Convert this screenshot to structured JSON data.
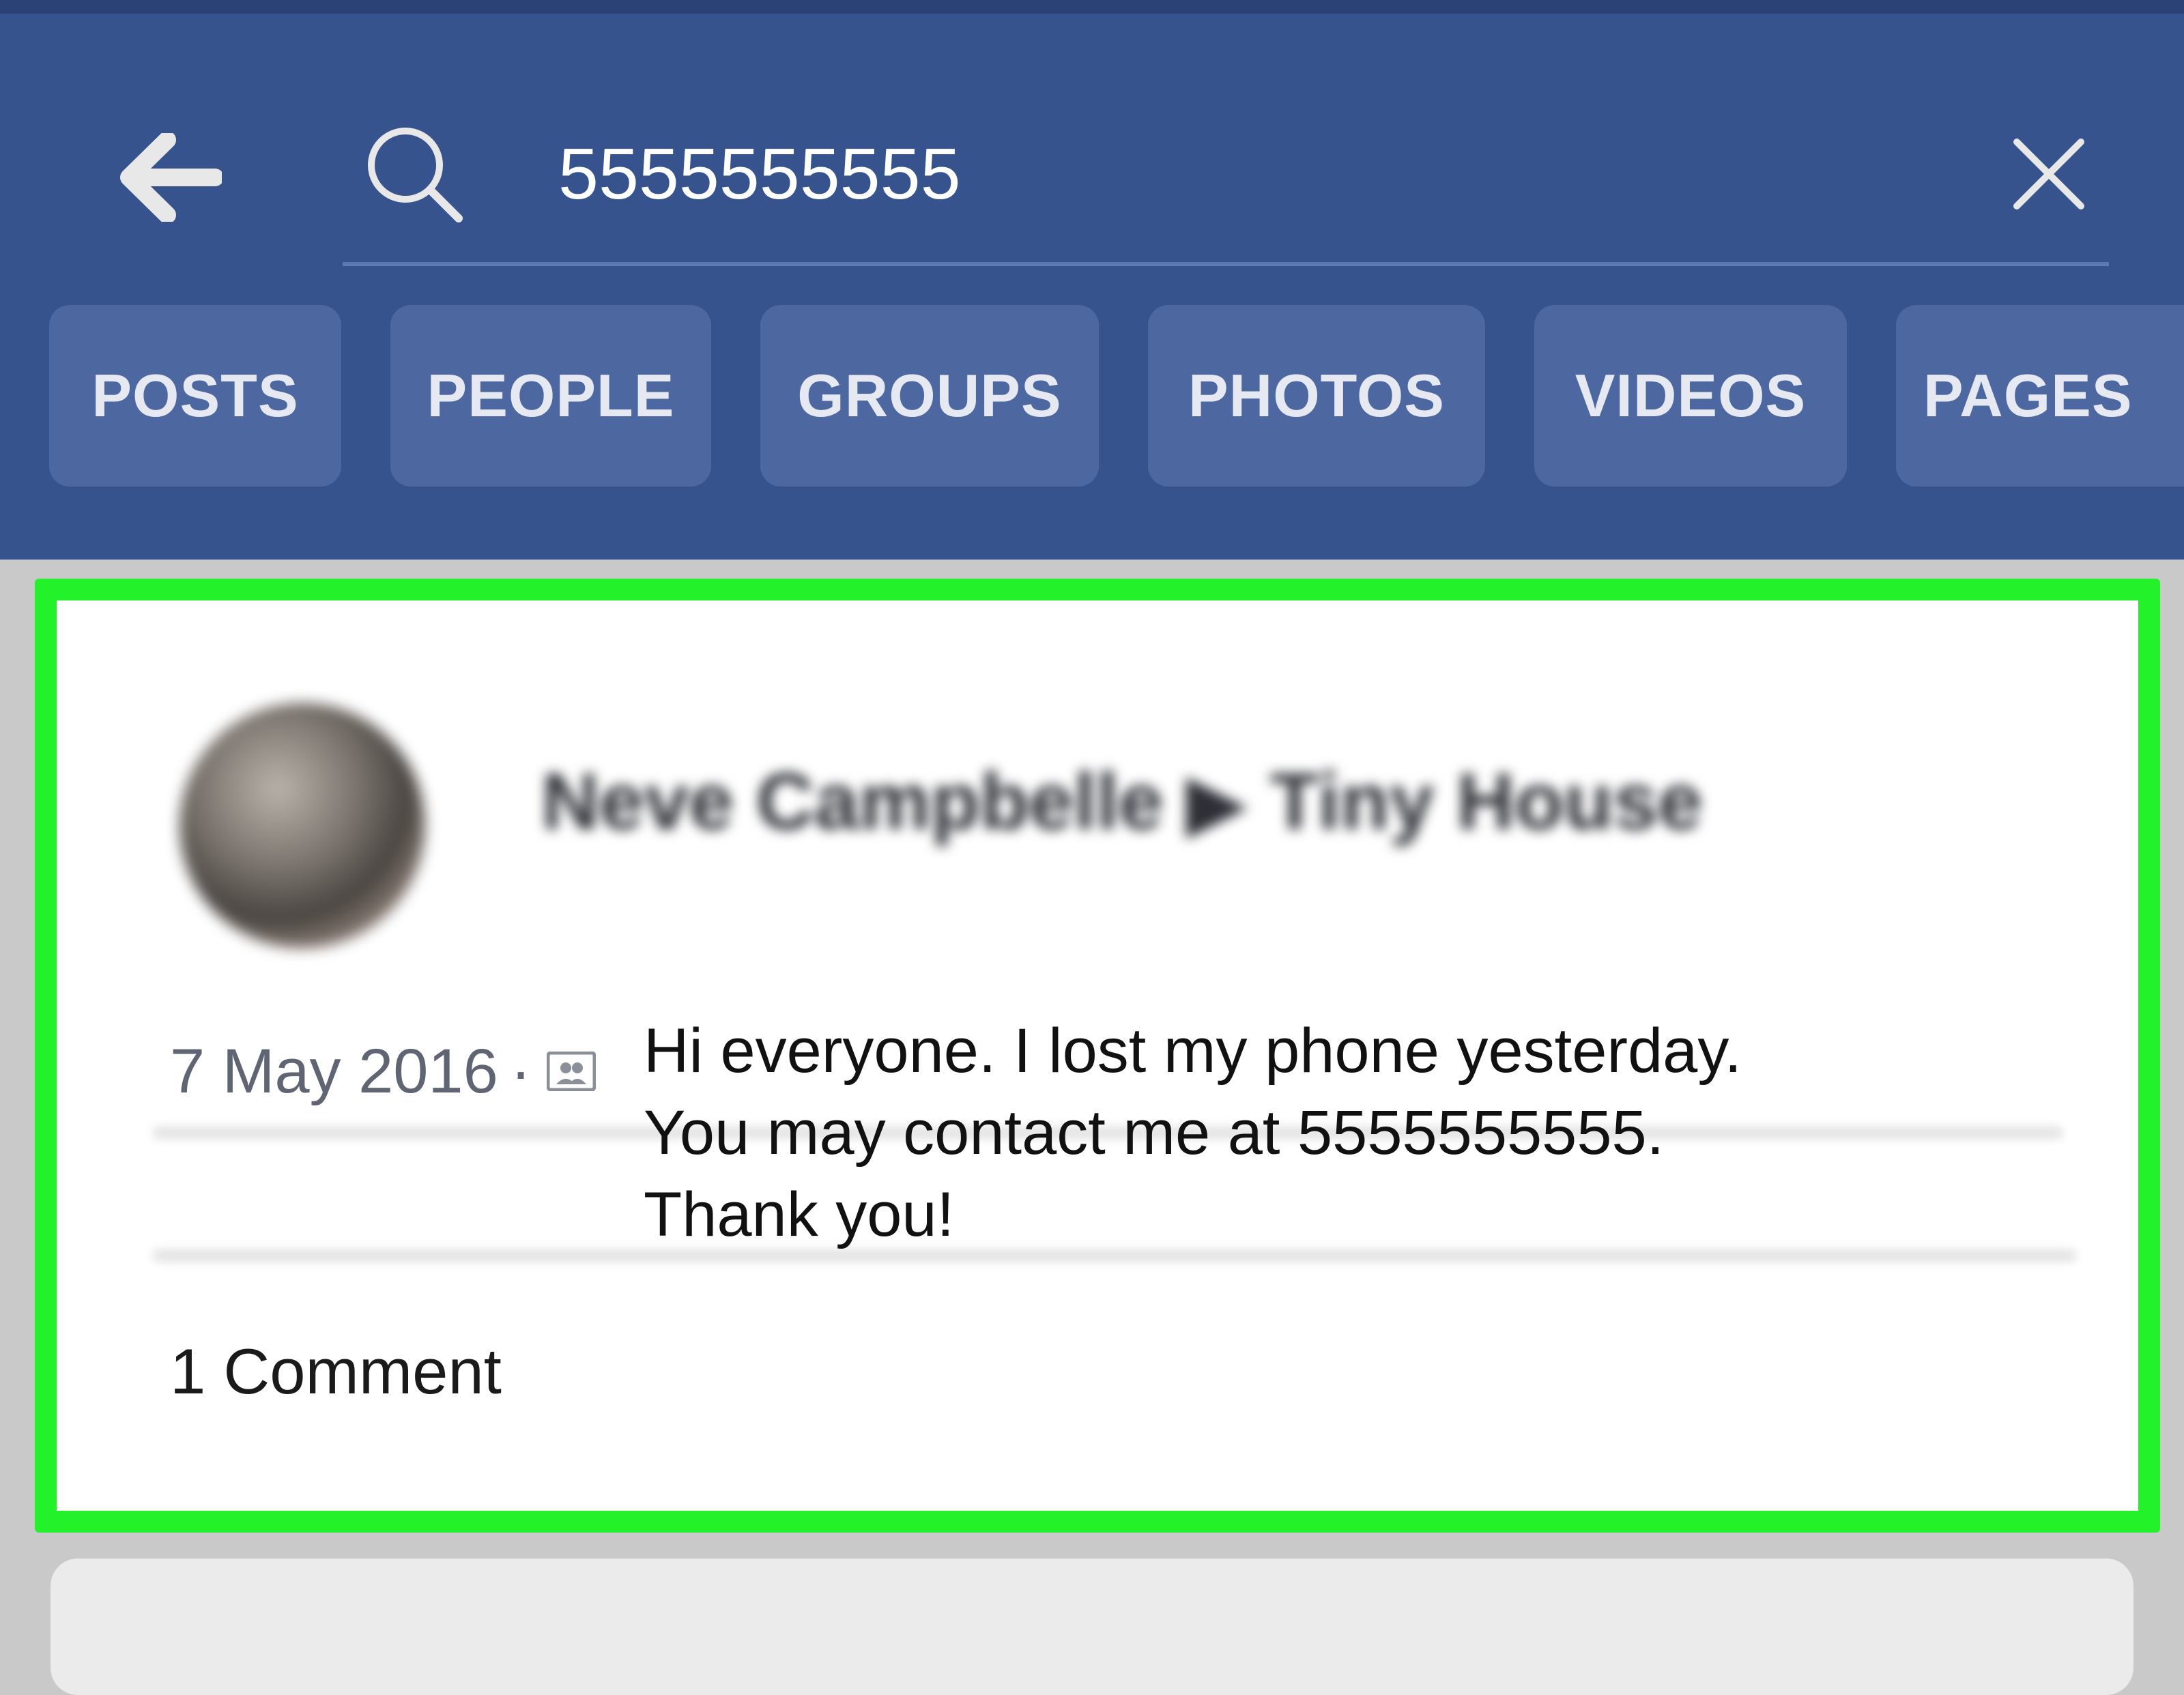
{
  "search": {
    "query": "5555555555"
  },
  "tabs": [
    {
      "label": "POSTS"
    },
    {
      "label": "PEOPLE"
    },
    {
      "label": "GROUPS"
    },
    {
      "label": "PHOTOS"
    },
    {
      "label": "VIDEOS"
    },
    {
      "label": "PAGES"
    }
  ],
  "post": {
    "author": "Neve Campbelle ▶ Tiny House",
    "date": "7 May 2016",
    "separator": "·",
    "lines": [
      "Hi everyone. I lost my phone yesterday.",
      "You may contact me at 5555555555.",
      "Thank you!"
    ],
    "comments": "1 Comment"
  },
  "icons": {
    "back": "arrow-left-icon",
    "search": "search-icon",
    "clear": "close-icon",
    "audience": "group-audience-icon"
  },
  "colors": {
    "header": "#36538e",
    "tab": "#4d67a0",
    "highlight": "#23f22b"
  }
}
